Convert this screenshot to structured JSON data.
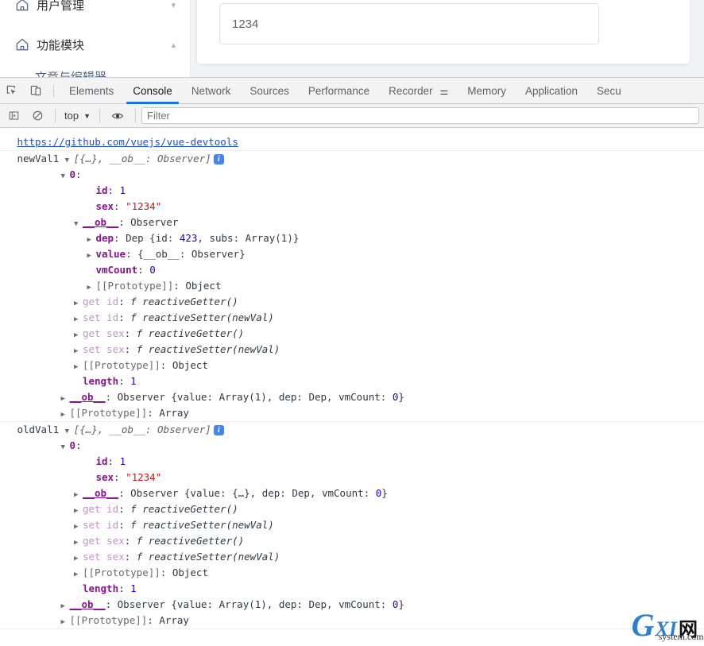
{
  "app": {
    "sidebar": {
      "items": [
        {
          "icon": "home-icon",
          "label": "用户管理",
          "arrow": "chevron-down"
        },
        {
          "icon": "home-icon",
          "label": "功能模块",
          "arrow": "chevron-up"
        },
        {
          "icon": "home-icon",
          "label": "文章与编辑器",
          "arrow": ""
        }
      ]
    },
    "input": {
      "value": "1234",
      "placeholder": ""
    }
  },
  "devtools": {
    "toolbar": {
      "inspect_icon": "inspect-element-icon",
      "device_icon": "device-toolbar-icon",
      "tabs": [
        {
          "label": "Elements",
          "active": false
        },
        {
          "label": "Console",
          "active": true
        },
        {
          "label": "Network",
          "active": false
        },
        {
          "label": "Sources",
          "active": false
        },
        {
          "label": "Performance",
          "active": false
        },
        {
          "label": "Recorder",
          "active": false,
          "badge": "flask-icon"
        },
        {
          "label": "Memory",
          "active": false
        },
        {
          "label": "Application",
          "active": false
        },
        {
          "label": "Secu",
          "active": false
        }
      ]
    },
    "filterbar": {
      "sidebar_toggle_icon": "console-sidebar-icon",
      "clear_icon": "clear-console-icon",
      "context": "top",
      "context_caret": "chevron-down-icon",
      "eye_icon": "live-expression-icon",
      "filter_placeholder": "Filter",
      "filter_value": ""
    },
    "accent": "#1a73e8",
    "console": {
      "link": "https://github.com/vuejs/vue-devtools",
      "groups": [
        {
          "name": "newVal1",
          "preview": "[{…}, __ob__: Observer]",
          "badge": "info-badge",
          "lines": [
            {
              "indent": 4,
              "tri": "open",
              "segs": [
                {
                  "t": "0",
                  "c": "prop"
                },
                {
                  "t": ":",
                  "c": "plain"
                }
              ]
            },
            {
              "indent": 6,
              "tri": "blank",
              "segs": [
                {
                  "t": "id",
                  "c": "prop"
                },
                {
                  "t": ": ",
                  "c": "plain"
                },
                {
                  "t": "1",
                  "c": "num"
                }
              ]
            },
            {
              "indent": 6,
              "tri": "blank",
              "segs": [
                {
                  "t": "sex",
                  "c": "prop"
                },
                {
                  "t": ": ",
                  "c": "plain"
                },
                {
                  "t": "\"1234\"",
                  "c": "str"
                }
              ]
            },
            {
              "indent": 5,
              "tri": "open",
              "segs": [
                {
                  "t": "__ob__",
                  "c": "obkey"
                },
                {
                  "t": ": ",
                  "c": "plain"
                },
                {
                  "t": "Observer",
                  "c": "plain"
                }
              ]
            },
            {
              "indent": 6,
              "tri": "closed",
              "segs": [
                {
                  "t": "dep",
                  "c": "prop"
                },
                {
                  "t": ": ",
                  "c": "plain"
                },
                {
                  "t": "Dep {",
                  "c": "plain"
                },
                {
                  "t": "id",
                  "c": "plain"
                },
                {
                  "t": ": ",
                  "c": "plain"
                },
                {
                  "t": "423",
                  "c": "num"
                },
                {
                  "t": ", subs: ",
                  "c": "plain"
                },
                {
                  "t": "Array(1)}",
                  "c": "plain"
                }
              ]
            },
            {
              "indent": 6,
              "tri": "closed",
              "segs": [
                {
                  "t": "value",
                  "c": "prop"
                },
                {
                  "t": ": {",
                  "c": "plain"
                },
                {
                  "t": "__ob__",
                  "c": "plain"
                },
                {
                  "t": ": Observer}",
                  "c": "plain"
                }
              ]
            },
            {
              "indent": 6,
              "tri": "blank",
              "segs": [
                {
                  "t": "vmCount",
                  "c": "prop"
                },
                {
                  "t": ": ",
                  "c": "plain"
                },
                {
                  "t": "0",
                  "c": "num"
                }
              ]
            },
            {
              "indent": 6,
              "tri": "closed",
              "segs": [
                {
                  "t": "[[Prototype]]",
                  "c": "proto"
                },
                {
                  "t": ": Object",
                  "c": "plain"
                }
              ]
            },
            {
              "indent": 5,
              "tri": "closed",
              "segs": [
                {
                  "t": "get id",
                  "c": "accessor"
                },
                {
                  "t": ": ",
                  "c": "plain"
                },
                {
                  "t": "f ",
                  "c": "fnkw"
                },
                {
                  "t": "reactiveGetter()",
                  "c": "fnname"
                }
              ]
            },
            {
              "indent": 5,
              "tri": "closed",
              "segs": [
                {
                  "t": "set id",
                  "c": "accessor"
                },
                {
                  "t": ": ",
                  "c": "plain"
                },
                {
                  "t": "f ",
                  "c": "fnkw"
                },
                {
                  "t": "reactiveSetter(newVal)",
                  "c": "fnname"
                }
              ]
            },
            {
              "indent": 5,
              "tri": "closed",
              "segs": [
                {
                  "t": "get sex",
                  "c": "accessor"
                },
                {
                  "t": ": ",
                  "c": "plain"
                },
                {
                  "t": "f ",
                  "c": "fnkw"
                },
                {
                  "t": "reactiveGetter()",
                  "c": "fnname"
                }
              ]
            },
            {
              "indent": 5,
              "tri": "closed",
              "segs": [
                {
                  "t": "set sex",
                  "c": "accessor"
                },
                {
                  "t": ": ",
                  "c": "plain"
                },
                {
                  "t": "f ",
                  "c": "fnkw"
                },
                {
                  "t": "reactiveSetter(newVal)",
                  "c": "fnname"
                }
              ]
            },
            {
              "indent": 5,
              "tri": "closed",
              "segs": [
                {
                  "t": "[[Prototype]]",
                  "c": "proto"
                },
                {
                  "t": ": Object",
                  "c": "plain"
                }
              ]
            },
            {
              "indent": 5,
              "tri": "blank",
              "segs": [
                {
                  "t": "length",
                  "c": "prop"
                },
                {
                  "t": ": ",
                  "c": "plain"
                },
                {
                  "t": "1",
                  "c": "num"
                }
              ]
            },
            {
              "indent": 4,
              "tri": "closed",
              "segs": [
                {
                  "t": "__ob__",
                  "c": "obkey"
                },
                {
                  "t": ": ",
                  "c": "plain"
                },
                {
                  "t": "Observer {value: Array(1), dep: Dep, vmCount: ",
                  "c": "plain"
                },
                {
                  "t": "0",
                  "c": "num"
                },
                {
                  "t": "}",
                  "c": "plain"
                }
              ]
            },
            {
              "indent": 4,
              "tri": "closed",
              "segs": [
                {
                  "t": "[[Prototype]]",
                  "c": "proto"
                },
                {
                  "t": ": Array",
                  "c": "plain"
                }
              ]
            }
          ]
        },
        {
          "name": "oldVal1",
          "preview": "[{…}, __ob__: Observer]",
          "badge": "info-badge",
          "lines": [
            {
              "indent": 4,
              "tri": "open",
              "segs": [
                {
                  "t": "0",
                  "c": "prop"
                },
                {
                  "t": ":",
                  "c": "plain"
                }
              ]
            },
            {
              "indent": 6,
              "tri": "blank",
              "segs": [
                {
                  "t": "id",
                  "c": "prop"
                },
                {
                  "t": ": ",
                  "c": "plain"
                },
                {
                  "t": "1",
                  "c": "num"
                }
              ]
            },
            {
              "indent": 6,
              "tri": "blank",
              "segs": [
                {
                  "t": "sex",
                  "c": "prop"
                },
                {
                  "t": ": ",
                  "c": "plain"
                },
                {
                  "t": "\"1234\"",
                  "c": "str"
                }
              ]
            },
            {
              "indent": 5,
              "tri": "closed",
              "segs": [
                {
                  "t": "__ob__",
                  "c": "obkey"
                },
                {
                  "t": ": ",
                  "c": "plain"
                },
                {
                  "t": "Observer {value: {…}, dep: Dep, vmCount: ",
                  "c": "plain"
                },
                {
                  "t": "0",
                  "c": "num"
                },
                {
                  "t": "}",
                  "c": "plain"
                }
              ]
            },
            {
              "indent": 5,
              "tri": "closed",
              "segs": [
                {
                  "t": "get id",
                  "c": "accessor"
                },
                {
                  "t": ": ",
                  "c": "plain"
                },
                {
                  "t": "f ",
                  "c": "fnkw"
                },
                {
                  "t": "reactiveGetter()",
                  "c": "fnname"
                }
              ]
            },
            {
              "indent": 5,
              "tri": "closed",
              "segs": [
                {
                  "t": "set id",
                  "c": "accessor"
                },
                {
                  "t": ": ",
                  "c": "plain"
                },
                {
                  "t": "f ",
                  "c": "fnkw"
                },
                {
                  "t": "reactiveSetter(newVal)",
                  "c": "fnname"
                }
              ]
            },
            {
              "indent": 5,
              "tri": "closed",
              "segs": [
                {
                  "t": "get sex",
                  "c": "accessor"
                },
                {
                  "t": ": ",
                  "c": "plain"
                },
                {
                  "t": "f ",
                  "c": "fnkw"
                },
                {
                  "t": "reactiveGetter()",
                  "c": "fnname"
                }
              ]
            },
            {
              "indent": 5,
              "tri": "closed",
              "segs": [
                {
                  "t": "set sex",
                  "c": "accessor"
                },
                {
                  "t": ": ",
                  "c": "plain"
                },
                {
                  "t": "f ",
                  "c": "fnkw"
                },
                {
                  "t": "reactiveSetter(newVal)",
                  "c": "fnname"
                }
              ]
            },
            {
              "indent": 5,
              "tri": "closed",
              "segs": [
                {
                  "t": "[[Prototype]]",
                  "c": "proto"
                },
                {
                  "t": ": Object",
                  "c": "plain"
                }
              ]
            },
            {
              "indent": 5,
              "tri": "blank",
              "segs": [
                {
                  "t": "length",
                  "c": "prop"
                },
                {
                  "t": ": ",
                  "c": "plain"
                },
                {
                  "t": "1",
                  "c": "num"
                }
              ]
            },
            {
              "indent": 4,
              "tri": "closed",
              "segs": [
                {
                  "t": "__ob__",
                  "c": "obkey"
                },
                {
                  "t": ": ",
                  "c": "plain"
                },
                {
                  "t": "Observer {value: Array(1), dep: Dep, vmCount: ",
                  "c": "plain"
                },
                {
                  "t": "0",
                  "c": "num"
                },
                {
                  "t": "}",
                  "c": "plain"
                }
              ]
            },
            {
              "indent": 4,
              "tri": "closed",
              "segs": [
                {
                  "t": "[[Prototype]]",
                  "c": "proto"
                },
                {
                  "t": ": Array",
                  "c": "plain"
                }
              ]
            }
          ]
        }
      ]
    }
  },
  "watermark": {
    "g": "G",
    "xi": "XI",
    "cn": "网",
    "domain": "system.com"
  }
}
